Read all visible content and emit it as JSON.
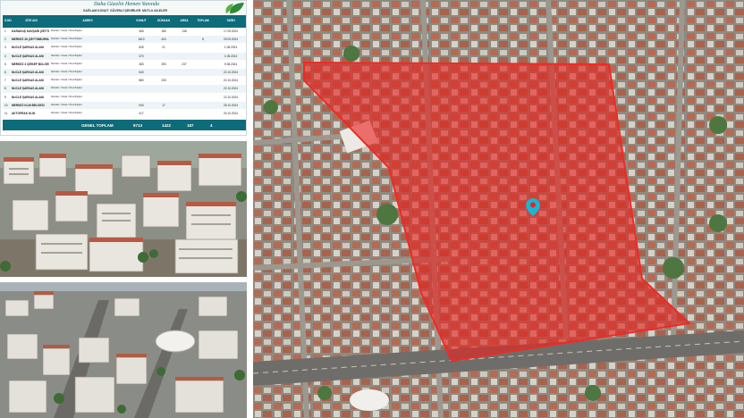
{
  "table": {
    "slogan": "Daha Güzelin Hemen Yanında",
    "subtitle_left": "SAĞLAM KONUT",
    "subtitle_mid": "GÜVENLİ ŞEHİRLER",
    "subtitle_right": "MUTLU AİLELER",
    "headers": [
      "S.NO",
      "SİTE ADI",
      "ADRES",
      "KONUT",
      "DÜKKAN",
      "ARSA",
      "TOPLAM",
      "TARİH"
    ],
    "rows": [
      {
        "no": "1",
        "name": "KARAKUŞ KAVŞAĞI (ZEYTİNBURNU)",
        "address": "Mahalle / Sokak / Bina Bilgileri",
        "c1": "465",
        "c2": "180",
        "c3": "138",
        "c4": "",
        "date": "17.09.2024"
      },
      {
        "no": "2",
        "name": "MERKEZ 26 (ZEYTİNBURNU)",
        "address": "Mahalle / Sokak / Bina Bilgileri",
        "c1": "1813",
        "c2": "404",
        "c3": "",
        "c4": "8",
        "date": "29.09.2024"
      },
      {
        "no": "3",
        "name": "NUCLE ŞARKAS ALANI",
        "address": "Mahalle / Sokak / Bina Bilgileri",
        "c1": "835",
        "c2": "21",
        "c3": "",
        "c4": "",
        "date": "1.08.2024"
      },
      {
        "no": "4",
        "name": "NUCLE ŞARKAS ALANI",
        "address": "Mahalle / Sokak / Bina Bilgileri",
        "c1": "370",
        "c2": "",
        "c3": "",
        "c4": "",
        "date": "1.08.2024"
      },
      {
        "no": "5",
        "name": "MERKEZ 3 ÇİRKEF BÖLGESİ",
        "address": "Mahalle / Sokak / Bina Bilgileri",
        "c1": "383",
        "c2": "390",
        "c3": "237",
        "c4": "",
        "date": "9.08.2024"
      },
      {
        "no": "6",
        "name": "NUCLE ŞARKAS ALANI",
        "address": "Mahalle / Sokak / Bina Bilgileri",
        "c1": "540",
        "c2": "",
        "c3": "",
        "c4": "",
        "date": "22.10.2024"
      },
      {
        "no": "7",
        "name": "NUCLE ŞARKAS ALANI",
        "address": "Mahalle / Sokak / Bina Bilgileri",
        "c1": "880",
        "c2": "205",
        "c3": "",
        "c4": "",
        "date": "22.10.2024"
      },
      {
        "no": "8",
        "name": "NUCLE ŞARKAS ALANI",
        "address": "Mahalle / Sokak / Bina Bilgileri",
        "c1": "",
        "c2": "",
        "c3": "",
        "c4": "",
        "date": "22.10.2024"
      },
      {
        "no": "9",
        "name": "NUCLE ŞARKAS ALANI",
        "address": "Mahalle / Sokak / Bina Bilgileri",
        "c1": "",
        "c2": "",
        "c3": "",
        "c4": "",
        "date": "22.10.2024"
      },
      {
        "no": "10",
        "name": "MERKEZ KLIN BELGESİ",
        "address": "Mahalle / Sokak / Bina Bilgileri",
        "c1": "940",
        "c2": "17",
        "c3": "",
        "c4": "",
        "date": "25.10.2024"
      },
      {
        "no": "11",
        "name": "AKTOPRAK KLİN",
        "address": "Mahalle / Sokak / Bina Bilgileri",
        "c1": "417",
        "c2": "",
        "c3": "",
        "c4": "",
        "date": "20.10.2024"
      }
    ],
    "total_label": "GENEL TOPLAM",
    "total_konut": "9713",
    "total_dukkan": "1422",
    "total_arsa": "187",
    "total_toplam": "4"
  },
  "colors": {
    "header_teal": "#0d6b7a",
    "area_red": "#e8231f",
    "pin": "#19b5d4"
  },
  "icons": [
    "location-pin-icon",
    "leaf-logo-icon"
  ]
}
